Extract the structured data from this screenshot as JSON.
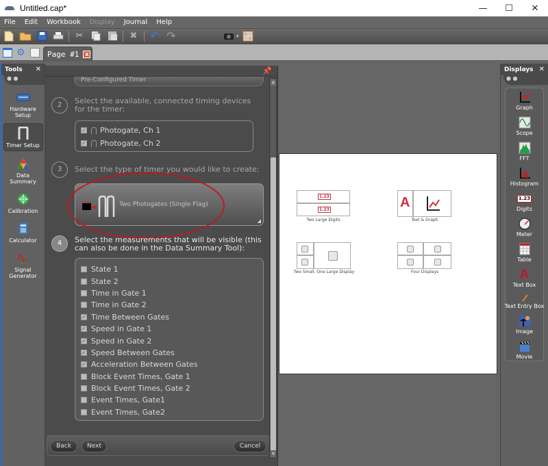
{
  "window": {
    "title": "Untitled.cap*",
    "controls": {
      "minimize": "—",
      "maximize": "☐",
      "close": "✕"
    }
  },
  "menu": [
    {
      "label": "File",
      "enabled": true
    },
    {
      "label": "Edit",
      "enabled": true
    },
    {
      "label": "Workbook",
      "enabled": true
    },
    {
      "label": "Display",
      "enabled": false
    },
    {
      "label": "Journal",
      "enabled": true
    },
    {
      "label": "Help",
      "enabled": true
    }
  ],
  "toolbar": {
    "icons": [
      "new-file-icon",
      "open-folder-icon",
      "save-icon",
      "print-icon",
      "cut-icon",
      "copy-icon",
      "paste-icon",
      "delete-icon",
      "undo-icon",
      "redo-icon",
      "camera-icon",
      "layout-icon"
    ]
  },
  "tabs": {
    "page_tab_label": "Page #1",
    "close_label": "x"
  },
  "tools_panel": {
    "title": "Tools",
    "close": "✕",
    "items": [
      {
        "label": "Hardware Setup",
        "selected": false
      },
      {
        "label": "Timer Setup",
        "selected": true
      },
      {
        "label": "Data Summary",
        "selected": false
      },
      {
        "label": "Calibration",
        "selected": false
      },
      {
        "label": "Calculator",
        "selected": false
      },
      {
        "label": "Signal Generator",
        "selected": false
      }
    ]
  },
  "wizard": {
    "dropdown_value": "Pre-Configured Timer",
    "steps": [
      {
        "number": "2",
        "text": "Select the available, connected timing devices for the timer:"
      },
      {
        "number": "3",
        "text": "Select the type of timer you would like to create:"
      },
      {
        "number": "4",
        "text": "Select the measurements that will be visible (this can also be done in the Data Summary Tool):"
      }
    ],
    "devices": [
      {
        "label": "Photogate, Ch 1",
        "checked": true
      },
      {
        "label": "Photogate, Ch 2",
        "checked": true
      }
    ],
    "timer_type": "Two Photogates (Single Flag)",
    "measurements": [
      {
        "label": "State 1",
        "checked": false
      },
      {
        "label": "State 2",
        "checked": false
      },
      {
        "label": "Time in Gate 1",
        "checked": false
      },
      {
        "label": "Time in Gate 2",
        "checked": false
      },
      {
        "label": "Time Between Gates",
        "checked": true
      },
      {
        "label": "Speed in Gate 1",
        "checked": true
      },
      {
        "label": "Speed in Gate 2",
        "checked": true
      },
      {
        "label": "Speed Between Gates",
        "checked": true
      },
      {
        "label": "Acceleration Between Gates",
        "checked": true
      },
      {
        "label": "Block Event Times, Gate 1",
        "checked": false
      },
      {
        "label": "Block Event Times, Gate 2",
        "checked": false
      },
      {
        "label": "Event Times, Gate1",
        "checked": false
      },
      {
        "label": "Event Times, Gate2",
        "checked": false
      }
    ],
    "buttons": {
      "back": "Back",
      "next": "Next",
      "cancel": "Cancel"
    }
  },
  "canvas": {
    "layouts": [
      {
        "label": "Two Large Digits",
        "digit": "1.23"
      },
      {
        "label": "Text & Graph",
        "letter": "A"
      },
      {
        "label": "Two Small, One Large Display"
      },
      {
        "label": "Four Displays"
      }
    ]
  },
  "displays_panel": {
    "title": "Displays",
    "close": "✕",
    "items": [
      {
        "label": "Graph"
      },
      {
        "label": "Scope"
      },
      {
        "label": "FFT"
      },
      {
        "label": "Histogram"
      },
      {
        "label": "Digits",
        "glyph": "1.23"
      },
      {
        "label": "Meter"
      },
      {
        "label": "Table"
      },
      {
        "label": "Text Box",
        "glyph": "A"
      },
      {
        "label": "Text Entry Box"
      },
      {
        "label": "Image"
      },
      {
        "label": "Movie"
      }
    ]
  },
  "colors": {
    "accent_red": "#c0181d",
    "checkbox": "#bcbcbc",
    "panel_bg": "#616161"
  }
}
